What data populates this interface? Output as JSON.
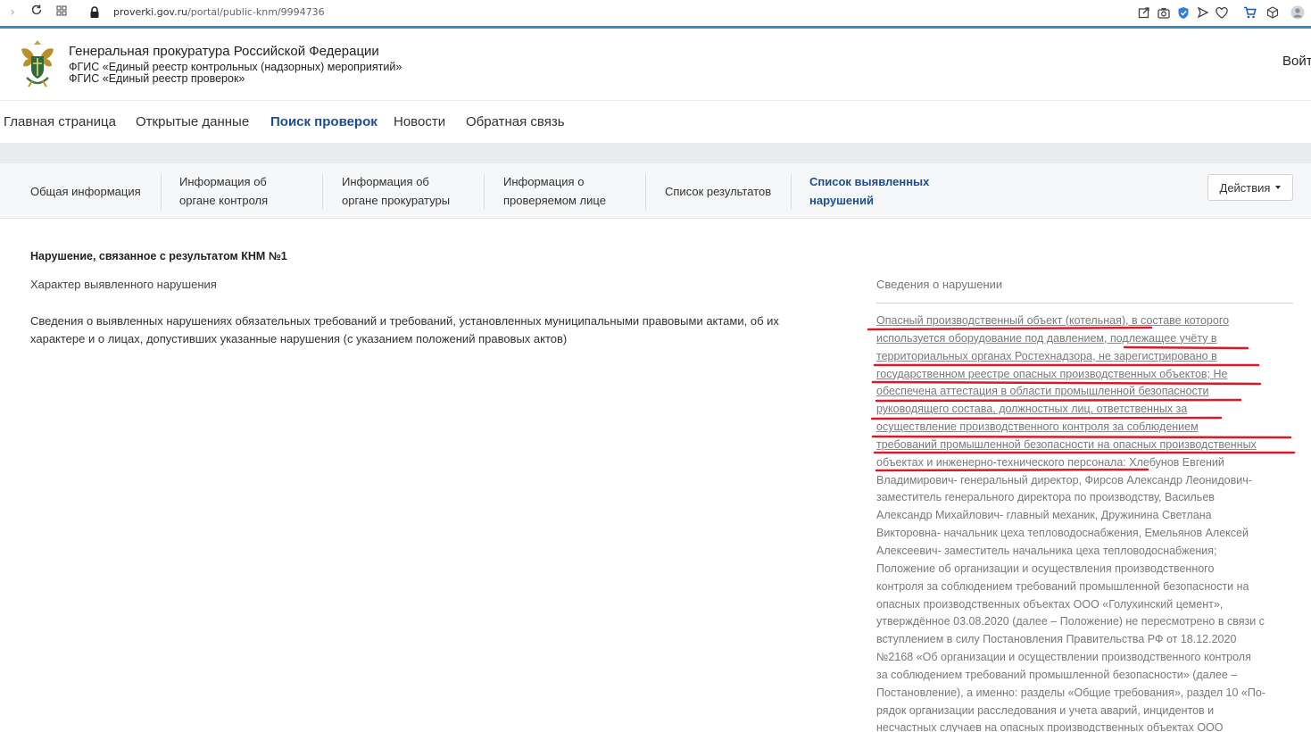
{
  "browser": {
    "url_domain": "proverki.gov.ru",
    "url_path": "/portal/public-knm/9994736"
  },
  "header": {
    "org_name": "Генеральная прокуратура Российской Федерации",
    "subtitle_1": "ФГИС «Единый реестр контрольных (надзорных) мероприятий»",
    "subtitle_2": "ФГИС «Единый реестр проверок»",
    "login": "Войти"
  },
  "nav": {
    "items": [
      {
        "label": "Главная страница"
      },
      {
        "label": "Открытые данные"
      },
      {
        "label": "Поиск проверок"
      },
      {
        "label": "Новости"
      },
      {
        "label": "Обратная связь"
      }
    ],
    "active": "Поиск проверок"
  },
  "tabs": {
    "items": [
      {
        "line1": "Общая информация",
        "line2": ""
      },
      {
        "line1": "Информация об",
        "line2": "органе контроля"
      },
      {
        "line1": "Информация об",
        "line2": "органе прокуратуры"
      },
      {
        "line1": "Информация о",
        "line2": "проверяемом лице"
      },
      {
        "line1": "Список результатов",
        "line2": ""
      },
      {
        "line1": "Список выявленных",
        "line2": "нарушений"
      }
    ],
    "actions_label": "Действия"
  },
  "content": {
    "section_title": "Нарушение, связанное с результатом КНМ №1",
    "col_left": "Характер выявленного нарушения",
    "col_right": "Сведения о нарушении",
    "row_left": "Сведения о выявленных нарушениях обязательных требований и требований, установленных муниципальными правовыми актами, об их характере и о лицах, допустивших указанные нарушения (с указанием положений правовых актов)",
    "details_lines": [
      "Опасный производственный объект (котельная), в составе которого",
      "используется оборудование под давлением, подлежащее учёту в",
      "территориальных органах Ростехнадзора, не зарегистрировано в",
      "государственном реестре опасных производственных объектов; Не",
      "обеспечена аттестация в области промышленной безопасности",
      "руководящего состава, должностных лиц, ответственных за",
      "осуществление производственного контроля за соблюдением",
      "требований промышленной безопасности на опасных производственных",
      "объектах и инженерно-технического персонала: Хлебунов Евгений",
      "Владимирович- генеральный директор, Фирсов Александр Леонидович-",
      "заместитель генерального директора по производству, Васильев",
      "Александр Михайлович- главный механик, Дружинина Светлана",
      "Викторовна- начальник цеха тепловодоснабжения, Емельянов Алексей",
      "Алексеевич- заместитель начальника цеха тепловодоснабжения;",
      "Положение об организации и осуществления производственного",
      "контроля за соблюдением требований промышленной безопасности на",
      "опасных производственных объектах ООО «Голухинский цемент»,",
      "утверждённое 03.08.2020 (далее – Положение) не пересмотрено в связи с",
      "вступлением в силу Постановления Правительства РФ от 18.12.2020",
      "№2168 «Об организации и осуществлении производственного контроля",
      "за соблюдением требований промышленной безопасности» (далее –",
      "Постановление), а именно: разделы «Общие требования», раздел 10 «По-",
      "рядок организации расследования и учета аварий, инцидентов и",
      "несчастных случаев на опасных производственных объектах ООО"
    ]
  }
}
